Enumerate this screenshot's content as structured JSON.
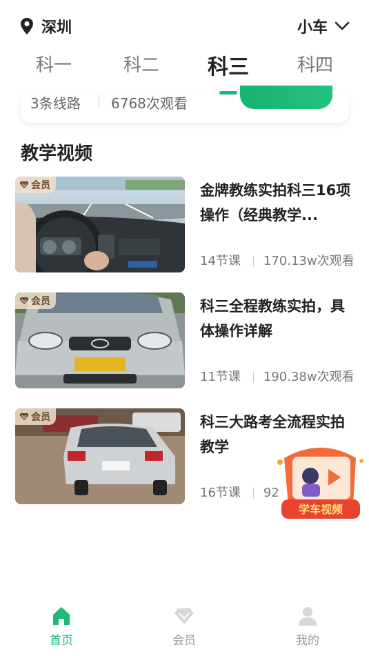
{
  "header": {
    "city": "深圳",
    "vehicle": "小车"
  },
  "tabs": [
    {
      "label": "科一",
      "active": false
    },
    {
      "label": "科二",
      "active": false
    },
    {
      "label": "科三",
      "active": true
    },
    {
      "label": "科四",
      "active": false
    }
  ],
  "route_card": {
    "routes": "3条线路",
    "views": "6768次观看"
  },
  "section": {
    "title": "教学视频"
  },
  "videos": [
    {
      "badge": "会员",
      "title": "金牌教练实拍科三16项操作（经典教学...",
      "lessons": "14节课",
      "views": "170.13w次观看"
    },
    {
      "badge": "会员",
      "title": "科三全程教练实拍，具体操作详解",
      "lessons": "11节课",
      "views": "190.38w次观看"
    },
    {
      "badge": "会员",
      "title": "科三大路考全流程实拍教学",
      "lessons": "16节课",
      "views": "92"
    }
  ],
  "float_ad": {
    "text": "学车视频"
  },
  "bottom_nav": [
    {
      "label": "首页",
      "active": true
    },
    {
      "label": "会员",
      "active": false
    },
    {
      "label": "我的",
      "active": false
    }
  ],
  "colors": {
    "accent": "#1db87a",
    "badge_bg": "#f0e1cd",
    "ad_red": "#e8432e"
  }
}
